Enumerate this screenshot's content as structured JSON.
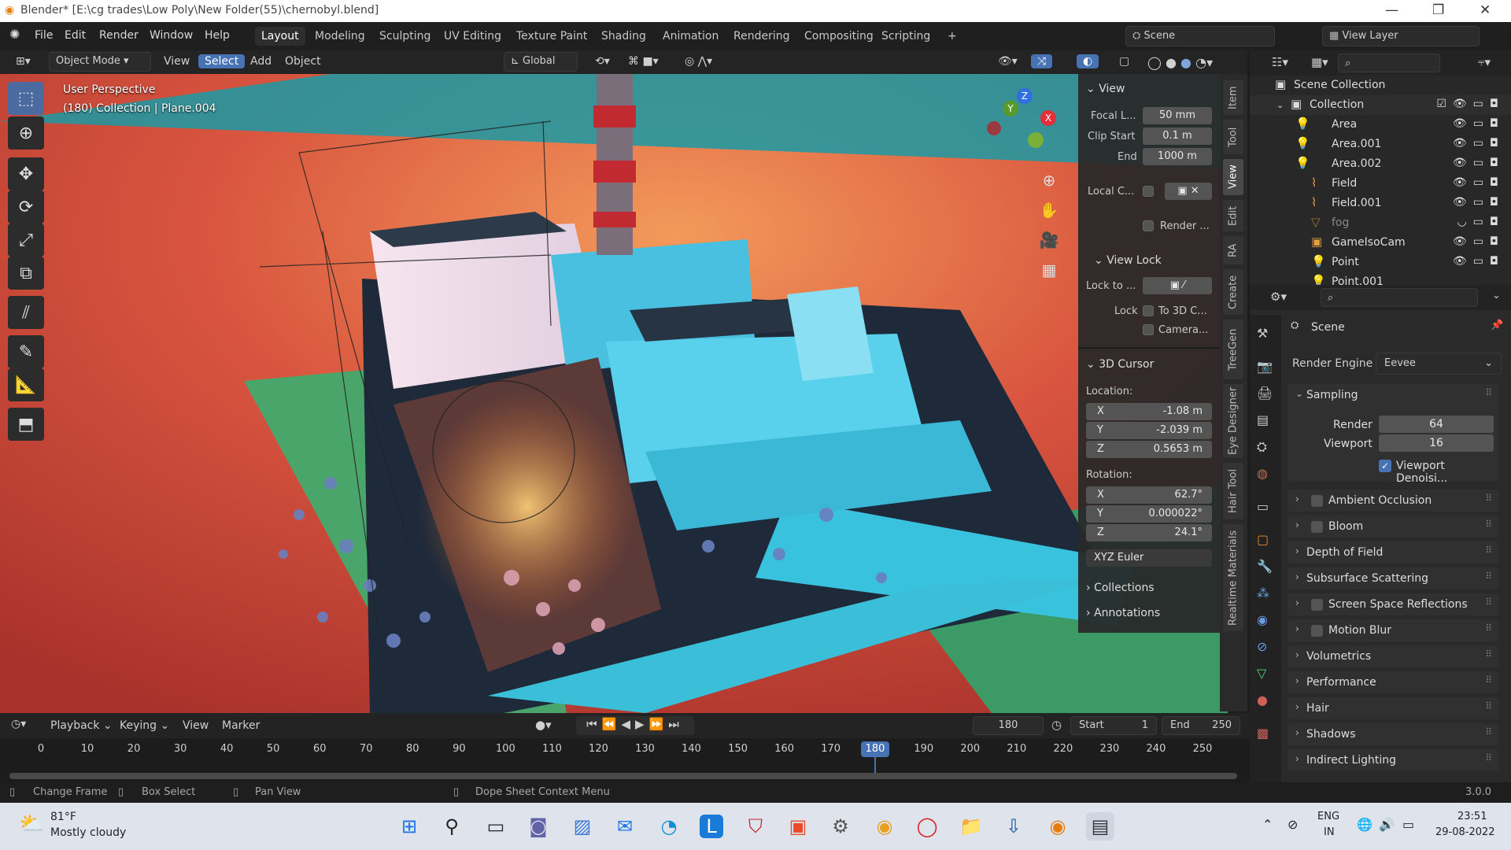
{
  "window": {
    "title": "Blender* [E:\\cg trades\\Low Poly\\New Folder(55)\\chernobyl.blend]",
    "minimize": "—",
    "restore": "❐",
    "close": "✕"
  },
  "menu": {
    "items": [
      "File",
      "Edit",
      "Render",
      "Window",
      "Help"
    ]
  },
  "workspaces": [
    "Layout",
    "Modeling",
    "Sculpting",
    "UV Editing",
    "Texture Paint",
    "Shading",
    "Animation",
    "Rendering",
    "Compositing",
    "Scripting",
    "+"
  ],
  "scene": {
    "name": "Scene",
    "view_layer": "View Layer"
  },
  "viewport_header": {
    "mode": "Object Mode",
    "menus": [
      "View",
      "Select",
      "Add",
      "Object"
    ],
    "transform": "Global"
  },
  "viewport": {
    "perspective": "User Perspective",
    "collection": "(180) Collection | Plane.004"
  },
  "gizmo": {
    "x": "X",
    "y": "Y",
    "z": "Z"
  },
  "npanel": {
    "view_title": "View",
    "focal_label": "Focal L...",
    "focal_value": "50 mm",
    "clip_start_label": "Clip Start",
    "clip_start_value": "0.1 m",
    "clip_end_label": "End",
    "clip_end_value": "1000 m",
    "local_camera_label": "Local C...",
    "render_label": "Render ...",
    "view_lock_title": "View Lock",
    "lock_to_label": "Lock to ...",
    "lock_label": "Lock",
    "lock_3d_label": "To 3D C...",
    "lock_camera_label": "Camera...",
    "cursor_title": "3D Cursor",
    "location_label": "Location:",
    "loc": [
      {
        "k": "X",
        "v": "-1.08 m"
      },
      {
        "k": "Y",
        "v": "-2.039 m"
      },
      {
        "k": "Z",
        "v": "0.5653 m"
      }
    ],
    "rotation_label": "Rotation:",
    "rot": [
      {
        "k": "X",
        "v": "62.7°"
      },
      {
        "k": "Y",
        "v": "0.000022°"
      },
      {
        "k": "Z",
        "v": "24.1°"
      }
    ],
    "rotation_mode": "XYZ Euler",
    "collections": "Collections",
    "annotations": "Annotations"
  },
  "vtabs": [
    "Item",
    "Tool",
    "View",
    "Edit",
    "RA",
    "Create",
    "TreeGen",
    "Eye Designer",
    "Hair Tool",
    "Realtime Materials"
  ],
  "outliner": {
    "scene_collection": "Scene Collection",
    "collection": "Collection",
    "items": [
      "Area",
      "Area.001",
      "Area.002",
      "Field",
      "Field.001",
      "fog",
      "GameIsoCam",
      "Point",
      "Point.001"
    ]
  },
  "properties": {
    "scene_label": "Scene",
    "render_engine_label": "Render Engine",
    "render_engine": "Eevee",
    "sampling": "Sampling",
    "render_label": "Render",
    "render_value": "64",
    "viewport_label": "Viewport",
    "viewport_value": "16",
    "denoise": "Viewport Denoisi...",
    "sections": [
      "Ambient Occlusion",
      "Bloom",
      "Depth of Field",
      "Subsurface Scattering",
      "Screen Space Reflections",
      "Motion Blur",
      "Volumetrics",
      "Performance",
      "Hair",
      "Shadows",
      "Indirect Lighting"
    ]
  },
  "timeline": {
    "menus": [
      "Playback",
      "Keying",
      "View",
      "Marker"
    ],
    "current_frame": "180",
    "start_label": "Start",
    "start": "1",
    "end_label": "End",
    "end": "250",
    "ticks": [
      "0",
      "10",
      "20",
      "30",
      "40",
      "50",
      "60",
      "70",
      "80",
      "90",
      "100",
      "110",
      "120",
      "130",
      "140",
      "150",
      "160",
      "170",
      "180",
      "190",
      "200",
      "210",
      "220",
      "230",
      "240",
      "250"
    ],
    "playhead": "180"
  },
  "statusbar": {
    "change_frame": "Change Frame",
    "box_select": "Box Select",
    "pan_view": "Pan View",
    "context_menu": "Dope Sheet Context Menu",
    "version": "3.0.0"
  },
  "taskbar": {
    "temp": "81°F",
    "weather": "Mostly cloudy",
    "lang1": "ENG",
    "lang2": "IN",
    "time": "23:51",
    "date": "29-08-2022"
  }
}
